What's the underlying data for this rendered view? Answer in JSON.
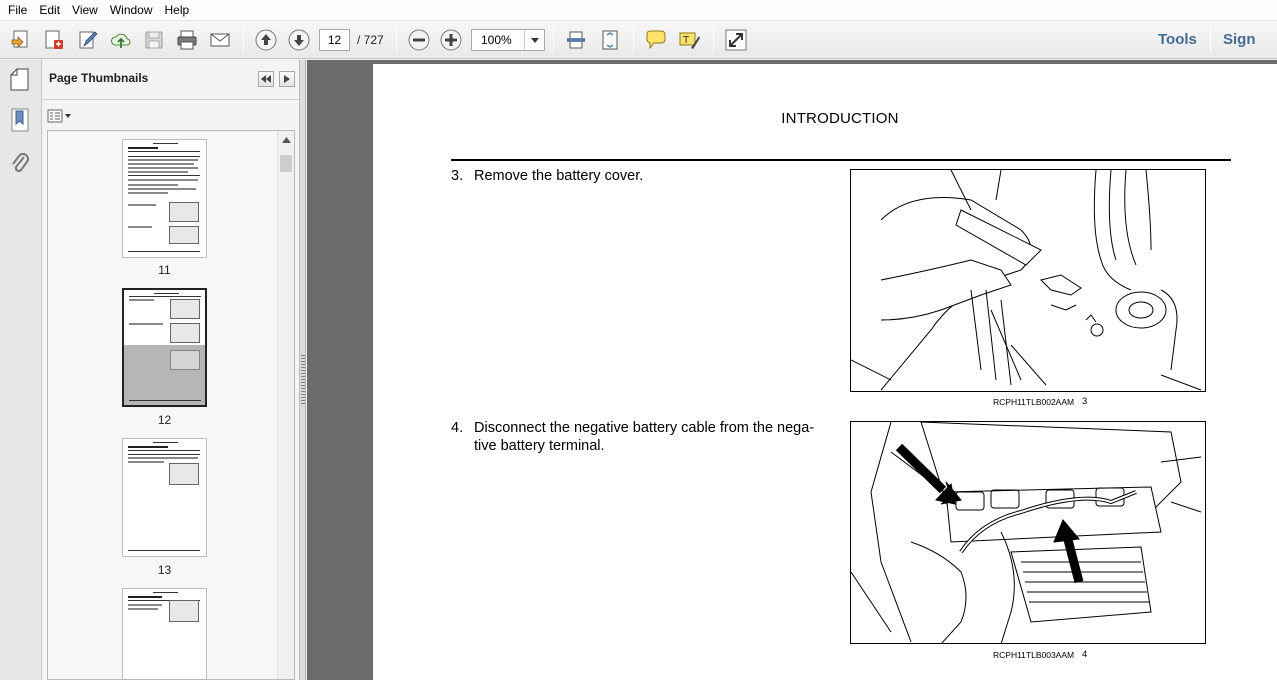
{
  "menu": [
    "File",
    "Edit",
    "View",
    "Window",
    "Help"
  ],
  "toolbar": {
    "page_current": "12",
    "page_total": "/  727",
    "zoom": "100%",
    "tools_label": "Tools",
    "sign_label": "Sign"
  },
  "panel": {
    "title": "Page Thumbnails",
    "thumbnails": [
      {
        "label": "11"
      },
      {
        "label": "12"
      },
      {
        "label": "13"
      },
      {
        "label": ""
      }
    ]
  },
  "document": {
    "heading": "INTRODUCTION",
    "steps": [
      {
        "num": "3.",
        "text": "Remove the battery cover.",
        "caption": "RCPH11TLB002AAM",
        "fig_num": "3"
      },
      {
        "num": "4.",
        "text": "Disconnect the negative battery cable from the nega-",
        "text2": "tive battery terminal.",
        "caption": "RCPH11TLB003AAM",
        "fig_num": "4"
      }
    ]
  },
  "icons": [
    "create-icon",
    "pdf-icon",
    "edit-icon",
    "cloud-upload-icon",
    "save-icon",
    "print-icon",
    "email-icon",
    "prev-page-icon",
    "next-page-icon",
    "zoom-out-icon",
    "zoom-in-icon",
    "fit-width-icon",
    "fit-page-icon",
    "comment-icon",
    "highlight-icon",
    "expand-icon",
    "page-icon",
    "bookmark-icon",
    "attachment-icon"
  ]
}
